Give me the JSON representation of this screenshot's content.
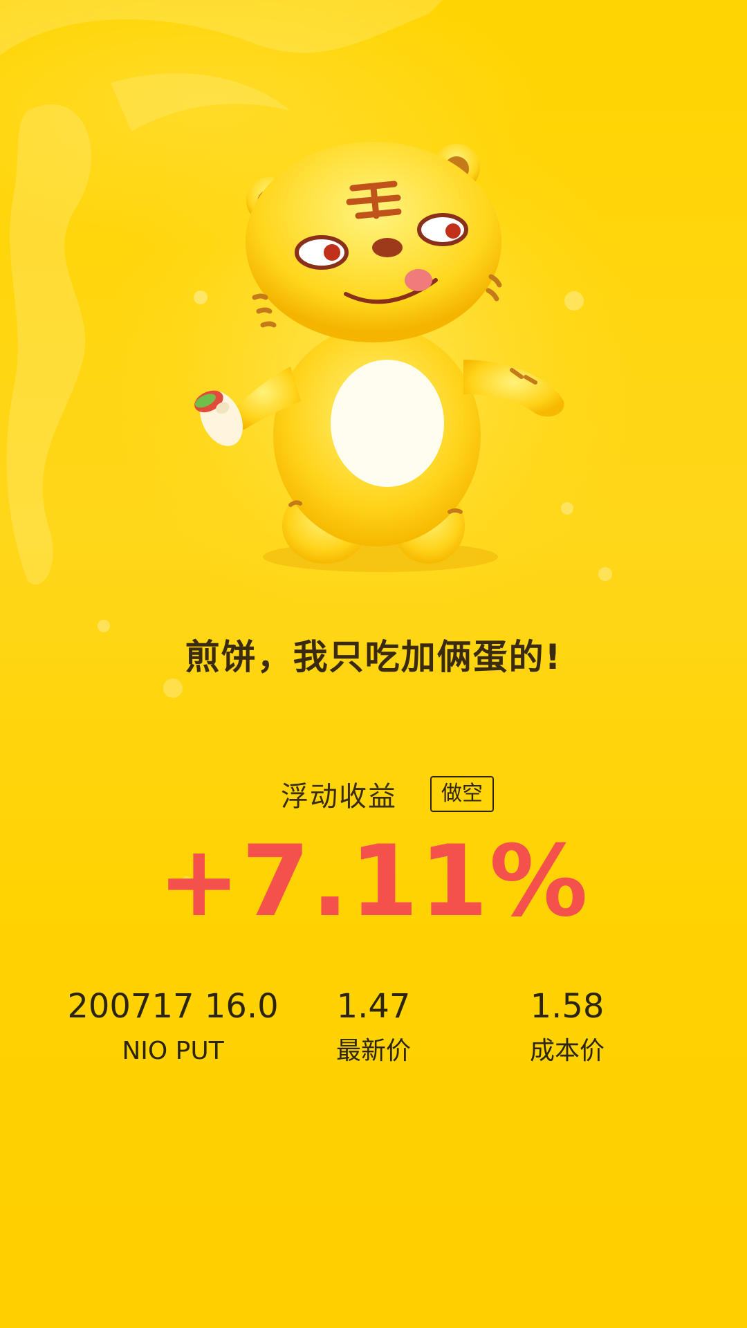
{
  "slogan": "煎饼，我只吃加俩蛋的!",
  "pnl": {
    "label": "浮动收益",
    "direction_badge": "做空",
    "value": "+7.11%"
  },
  "stats": {
    "contract": {
      "value": "200717 16.0",
      "label": "NIO PUT"
    },
    "last_price": {
      "value": "1.47",
      "label": "最新价"
    },
    "cost_price": {
      "value": "1.58",
      "label": "成本价"
    }
  },
  "colors": {
    "background": "#ffd400",
    "gain": "#f5514c",
    "text": "#2b2410"
  },
  "icons": {
    "mascot": "tiger-mascot-holding-pancake"
  }
}
